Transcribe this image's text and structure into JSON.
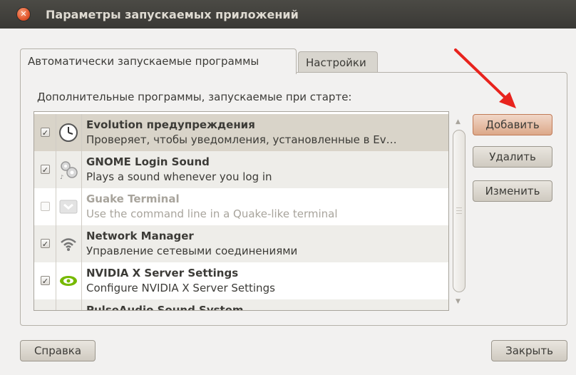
{
  "window": {
    "title": "Параметры запускаемых приложений"
  },
  "tabs": [
    {
      "label": "Автоматически запускаемые программы",
      "active": true
    },
    {
      "label": "Настройки",
      "active": false
    }
  ],
  "section_label": "Дополнительные программы, запускаемые при старте:",
  "startup_items": [
    {
      "name": "Evolution предупреждения",
      "description": "Проверяет, чтобы уведомления, установленные в Ev…",
      "enabled": true,
      "icon": "clock-icon"
    },
    {
      "name": "GNOME Login Sound",
      "description": "Plays a sound whenever you log in",
      "enabled": true,
      "icon": "gears-sound-icon"
    },
    {
      "name": "Guake Terminal",
      "description": "Use the command line in a Quake-like terminal",
      "enabled": false,
      "icon": "terminal-icon"
    },
    {
      "name": "Network Manager",
      "description": "Управление сетевыми соединениями",
      "enabled": true,
      "icon": "wifi-icon"
    },
    {
      "name": "NVIDIA X Server Settings",
      "description": "Configure NVIDIA X Server Settings",
      "enabled": true,
      "icon": "nvidia-icon"
    },
    {
      "name": "PulseAudio Sound System",
      "description": "",
      "enabled": false,
      "icon": "speaker-icon"
    }
  ],
  "buttons": {
    "add": "Добавить",
    "remove": "Удалить",
    "edit": "Изменить",
    "help": "Справка",
    "close": "Закрыть"
  },
  "colors": {
    "annotation_arrow": "#e8231d",
    "titlebar": "#3c3b37",
    "focus_button": "#dca889"
  }
}
